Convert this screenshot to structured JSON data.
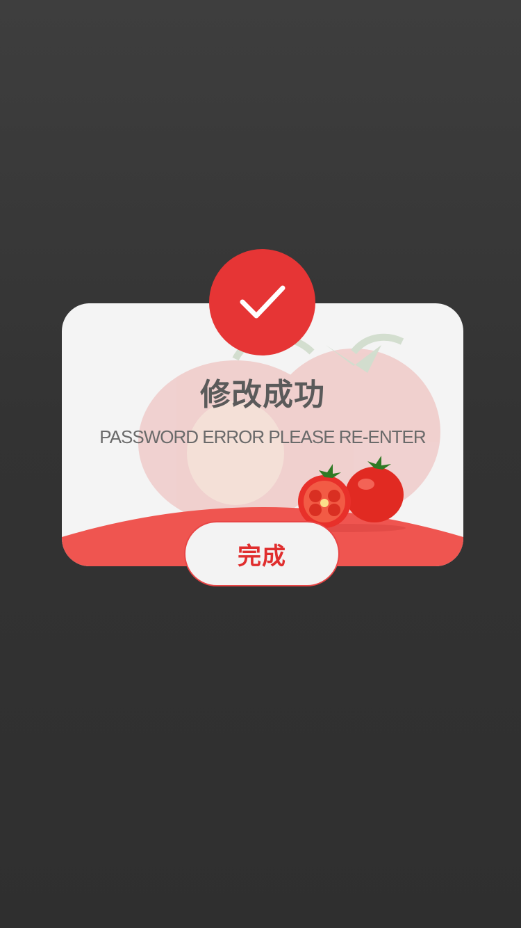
{
  "dialog": {
    "title": "修改成功",
    "message": "PASSWORD ERROR PLEASE RE-ENTER",
    "done_button_label": "完成",
    "badge_icon": "checkmark-icon",
    "illustration": "tomato-illustration"
  },
  "colors": {
    "backdrop": "#333333",
    "card_background": "#f4f4f4",
    "accent_red": "#e63535",
    "wave_red": "#ef5550",
    "title_text": "#5a5a5a",
    "message_text": "#6a6a6a",
    "button_text": "#e02e2e"
  }
}
